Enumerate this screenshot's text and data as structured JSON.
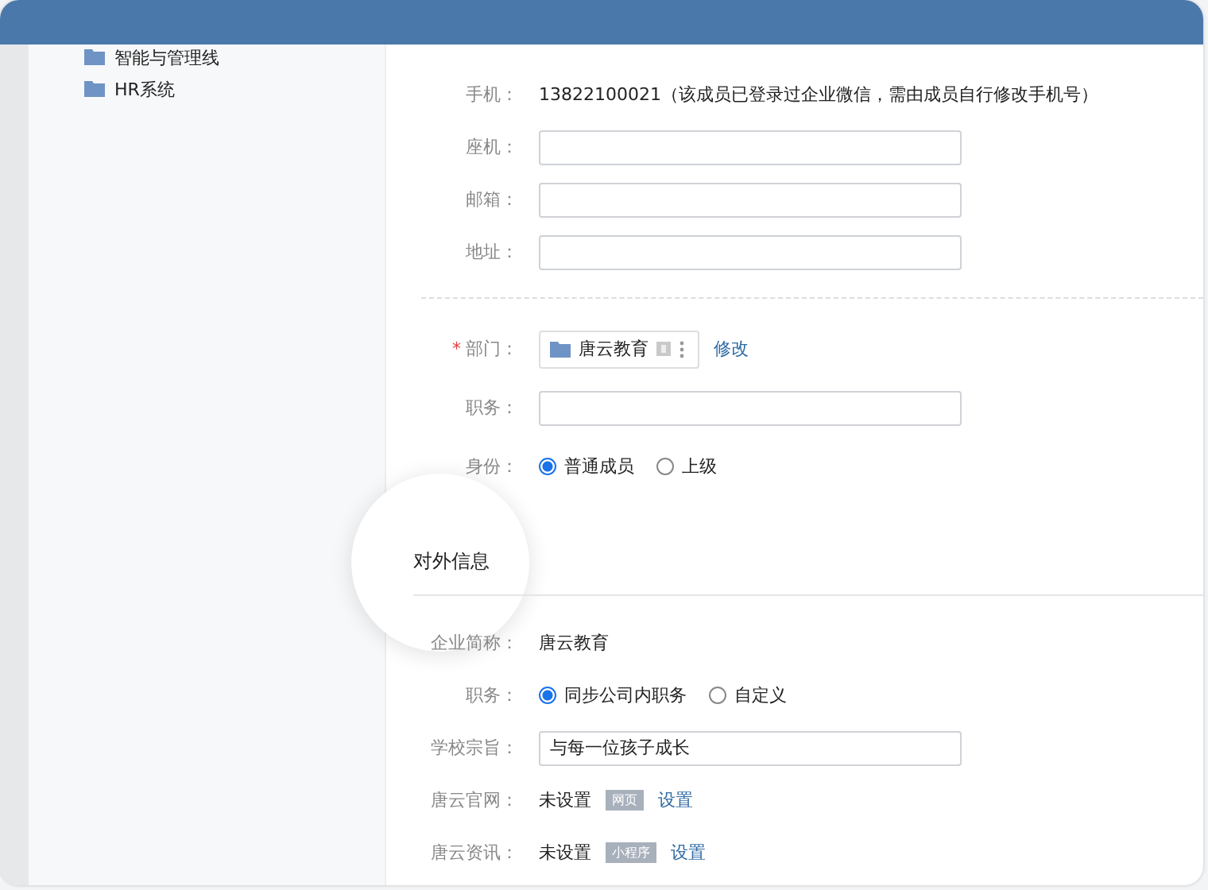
{
  "sidebar": {
    "items": [
      {
        "label": "智能与管理线"
      },
      {
        "label": "HR系统"
      }
    ]
  },
  "contact_fields": [
    {
      "kind": "text",
      "label": "手机：",
      "value": "13822100021（该成员已登录过企业微信，需由成员自行修改手机号）"
    },
    {
      "kind": "input",
      "label": "座机："
    },
    {
      "kind": "input",
      "label": "邮箱："
    },
    {
      "kind": "input",
      "label": "地址："
    }
  ],
  "org_fields": [
    {
      "kind": "department",
      "label": "部门：",
      "required_mark": "*",
      "department": "唐云教育",
      "link": "修改"
    },
    {
      "kind": "input",
      "label": "职务："
    },
    {
      "kind": "radio",
      "label": "身份：",
      "options": [
        {
          "label": "普通成员",
          "selected": true
        },
        {
          "label": "上级",
          "selected": false
        }
      ]
    }
  ],
  "external": {
    "title": "对外信息",
    "fields": [
      {
        "kind": "text",
        "label": "企业简称：",
        "value": "唐云教育"
      },
      {
        "kind": "radio",
        "label": "职务：",
        "options": [
          {
            "label": "同步公司内职务",
            "selected": true
          },
          {
            "label": "自定义",
            "selected": false
          }
        ]
      },
      {
        "kind": "input",
        "label": "学校宗旨：",
        "value": "与每一位孩子成长"
      },
      {
        "kind": "tagged",
        "label": "唐云官网：",
        "value": "未设置",
        "tag": "网页",
        "link": "设置"
      },
      {
        "kind": "tagged",
        "label": "唐云资讯：",
        "value": "未设置",
        "tag": "小程序",
        "link": "设置"
      }
    ]
  }
}
